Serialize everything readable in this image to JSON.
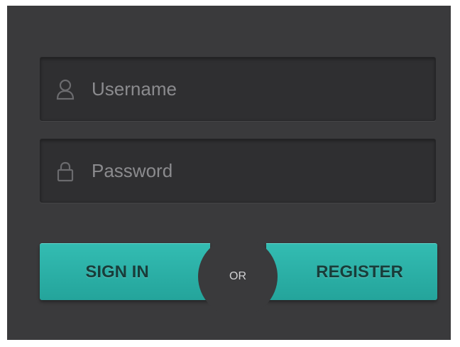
{
  "login": {
    "username_placeholder": "Username",
    "password_placeholder": "Password",
    "signin_label": "SIGN IN",
    "or_label": "OR",
    "register_label": "REGISTER"
  },
  "icons": {
    "username": "user-icon",
    "password": "lock-icon"
  },
  "colors": {
    "background": "#3a3a3c",
    "field": "#2f2f31",
    "accent": "#2fb3a9",
    "button_text": "#183d3a"
  }
}
